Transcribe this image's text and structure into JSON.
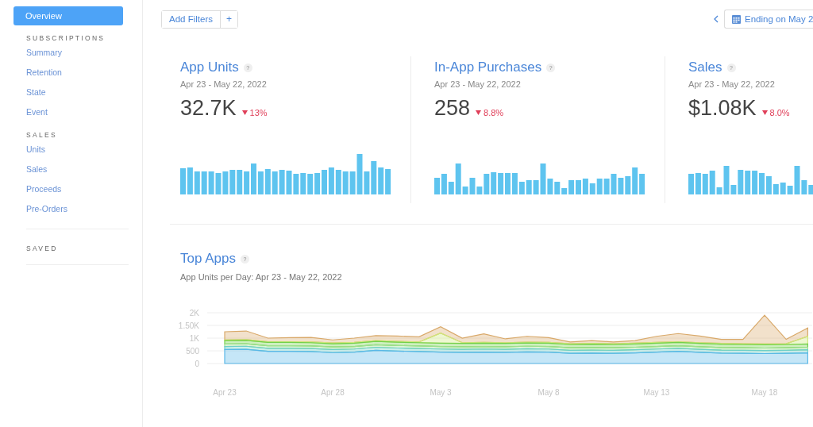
{
  "sidebar": {
    "items": [
      {
        "label": "Overview",
        "selected": true
      }
    ],
    "sections": [
      {
        "heading": "SUBSCRIPTIONS",
        "items": [
          {
            "label": "Summary",
            "selected": false
          },
          {
            "label": "Retention",
            "selected": false
          },
          {
            "label": "State",
            "selected": false
          },
          {
            "label": "Event",
            "selected": false
          }
        ]
      },
      {
        "heading": "SALES",
        "items": [
          {
            "label": "Units",
            "selected": false
          },
          {
            "label": "Sales",
            "selected": false
          },
          {
            "label": "Proceeds",
            "selected": false
          },
          {
            "label": "Pre-Orders",
            "selected": false
          }
        ]
      },
      {
        "heading": "SAVED"
      }
    ]
  },
  "toolbar": {
    "filter_button": "Add Filters",
    "add_button": "+",
    "date_button": "Ending on May 2"
  },
  "metrics": [
    {
      "title": "App Units",
      "help": "?",
      "period": "Apr 23 - May 22, 2022",
      "value": "32.7K",
      "change": "13%",
      "declined": true
    },
    {
      "title": "In-App Purchases",
      "help": "?",
      "period": "Apr 23 - May 22, 2022",
      "value": "258",
      "change": "8.8%",
      "declined": true
    },
    {
      "title": "Sales",
      "help": "?",
      "period": "Apr 23 - May 22, 2022",
      "value": "$1.08K",
      "change": "8.0%",
      "declined": true
    }
  ],
  "top_apps": {
    "title": "Top Apps",
    "help": "?",
    "subtitle": "App Units per Day: Apr 23 - May 22, 2022",
    "chart_data": {
      "type": "area",
      "stacked": true,
      "grid": true,
      "categories": [
        "Apr 23",
        null,
        null,
        null,
        null,
        "Apr 28",
        null,
        null,
        null,
        null,
        "May 3",
        null,
        null,
        null,
        null,
        "May 8",
        null,
        null,
        null,
        null,
        "May 13",
        null,
        null,
        null,
        null,
        "May 18",
        null,
        null
      ],
      "yticks": [
        0,
        500,
        {
          "value": 1000,
          "label": "1K"
        },
        {
          "value": 1500,
          "label": "1.50K"
        },
        {
          "value": 2000,
          "label": "2K"
        }
      ],
      "ylim": [
        0,
        2000
      ],
      "series": [
        {
          "color": "#5ab8e8",
          "values": [
            550,
            560,
            480,
            480,
            470,
            430,
            450,
            520,
            490,
            470,
            450,
            440,
            450,
            440,
            460,
            450,
            400,
            410,
            400,
            420,
            450,
            480,
            440,
            410,
            400,
            390,
            400,
            420
          ]
        },
        {
          "color": "#6fd0c8",
          "values": [
            120,
            120,
            120,
            120,
            120,
            120,
            120,
            120,
            120,
            120,
            120,
            120,
            120,
            120,
            120,
            120,
            120,
            120,
            120,
            120,
            120,
            120,
            120,
            120,
            120,
            120,
            120,
            120
          ]
        },
        {
          "color": "#9ee08e",
          "values": [
            100,
            100,
            100,
            100,
            100,
            100,
            100,
            100,
            100,
            100,
            100,
            100,
            100,
            100,
            100,
            100,
            100,
            100,
            100,
            100,
            100,
            100,
            100,
            100,
            100,
            100,
            100,
            100
          ]
        },
        {
          "color": "#72d04a",
          "values": [
            130,
            130,
            130,
            130,
            130,
            130,
            130,
            130,
            130,
            130,
            130,
            130,
            130,
            130,
            130,
            130,
            130,
            130,
            130,
            130,
            130,
            130,
            130,
            130,
            130,
            130,
            130,
            130
          ]
        },
        {
          "color": "#cfe87a",
          "values": [
            30,
            30,
            30,
            30,
            30,
            30,
            30,
            30,
            30,
            30,
            400,
            30,
            30,
            30,
            30,
            30,
            30,
            30,
            30,
            30,
            30,
            30,
            30,
            30,
            30,
            30,
            30,
            300
          ]
        },
        {
          "color": "#d9a96a",
          "values": [
            320,
            340,
            140,
            160,
            180,
            120,
            170,
            200,
            210,
            200,
            250,
            180,
            340,
            150,
            230,
            190,
            70,
            110,
            70,
            100,
            240,
            320,
            260,
            160,
            170,
            1130,
            170,
            330
          ]
        }
      ]
    }
  }
}
